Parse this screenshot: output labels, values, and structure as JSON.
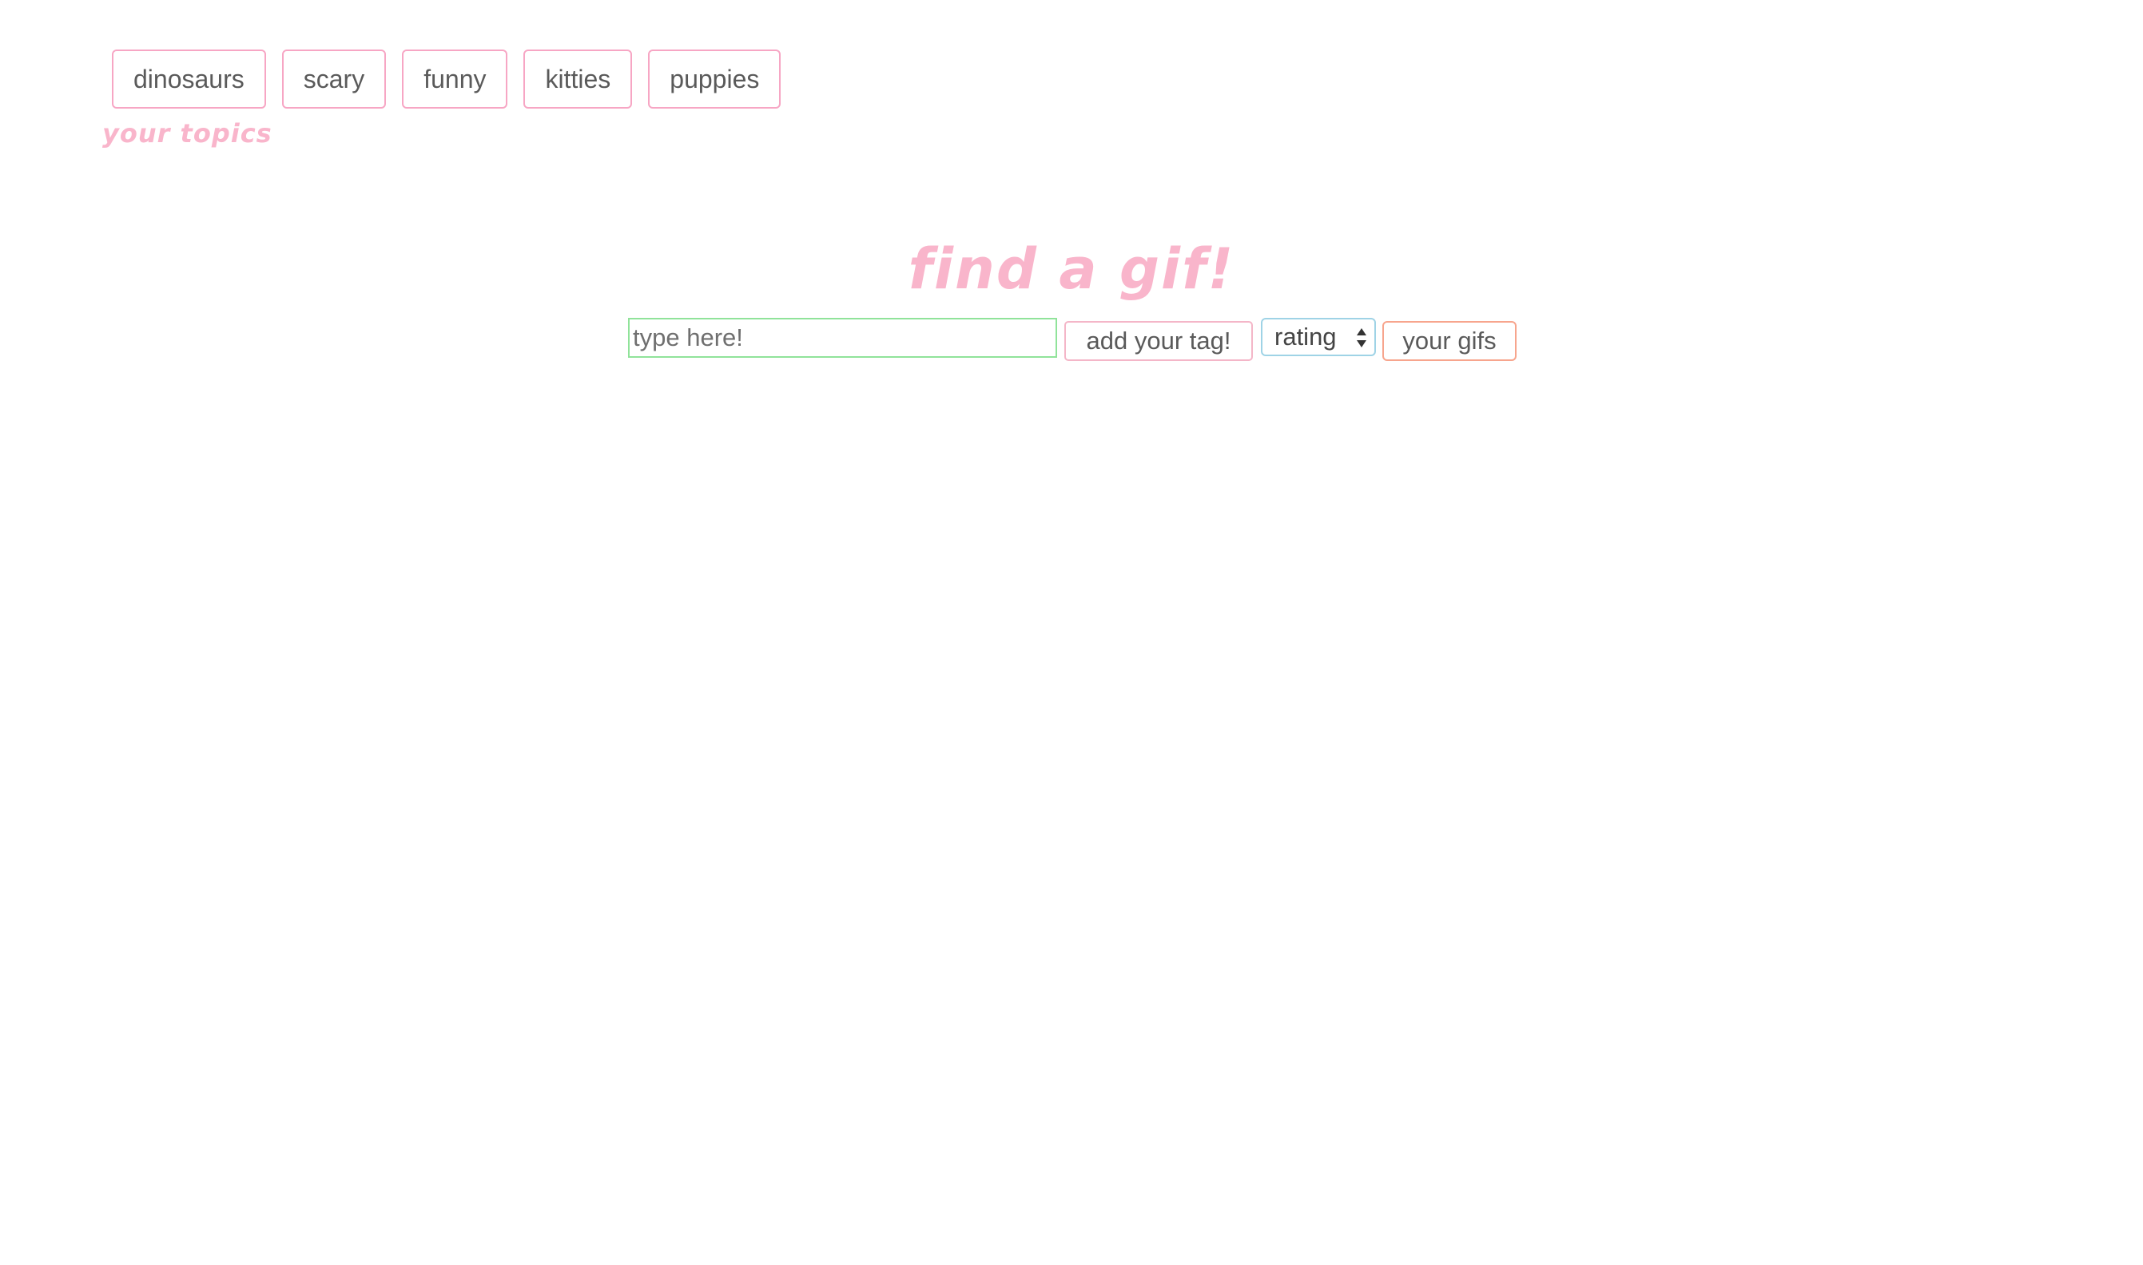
{
  "topics": {
    "buttons": [
      "dinosaurs",
      "scary",
      "funny",
      "kitties",
      "puppies"
    ],
    "caption": "your topics"
  },
  "title": "find a gif!",
  "search": {
    "placeholder": "type here!",
    "value": "",
    "add_tag_label": "add your tag!",
    "rating_label": "rating",
    "your_gifs_label": "your gifs"
  },
  "colors": {
    "accent_pink": "#f9b5cb",
    "input_border": "#90e39a",
    "select_border": "#9fd3e6",
    "your_gifs_border": "#f7a58d"
  },
  "icons": {
    "rating_select": "select-arrows-icon"
  }
}
